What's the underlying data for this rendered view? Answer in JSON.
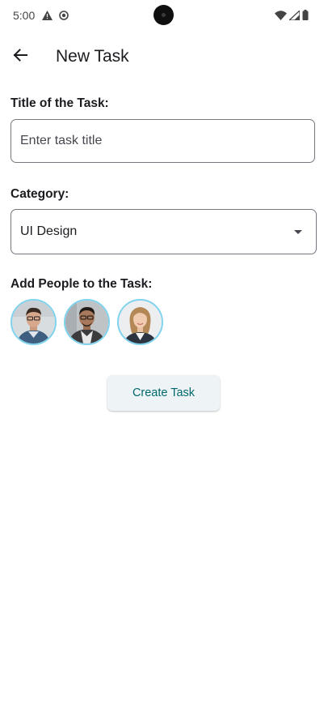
{
  "status_bar": {
    "time": "5:00",
    "left_icons": [
      "alert-triangle-icon",
      "sync-circle-icon"
    ],
    "right_icons": [
      "wifi-icon",
      "signal-icon",
      "battery-icon"
    ]
  },
  "app_bar": {
    "back_icon": "arrow-left-icon",
    "title": "New Task"
  },
  "form": {
    "title_label": "Title of the Task:",
    "title_placeholder": "Enter task title",
    "title_value": "",
    "category_label": "Category:",
    "category_value": "UI Design",
    "people_label": "Add People to the Task:",
    "people": [
      {
        "avatar": "person-1"
      },
      {
        "avatar": "person-2"
      },
      {
        "avatar": "person-3"
      }
    ],
    "accent_color": "#7fd3ee"
  },
  "actions": {
    "create_label": "Create Task",
    "create_color": "#00696d"
  }
}
